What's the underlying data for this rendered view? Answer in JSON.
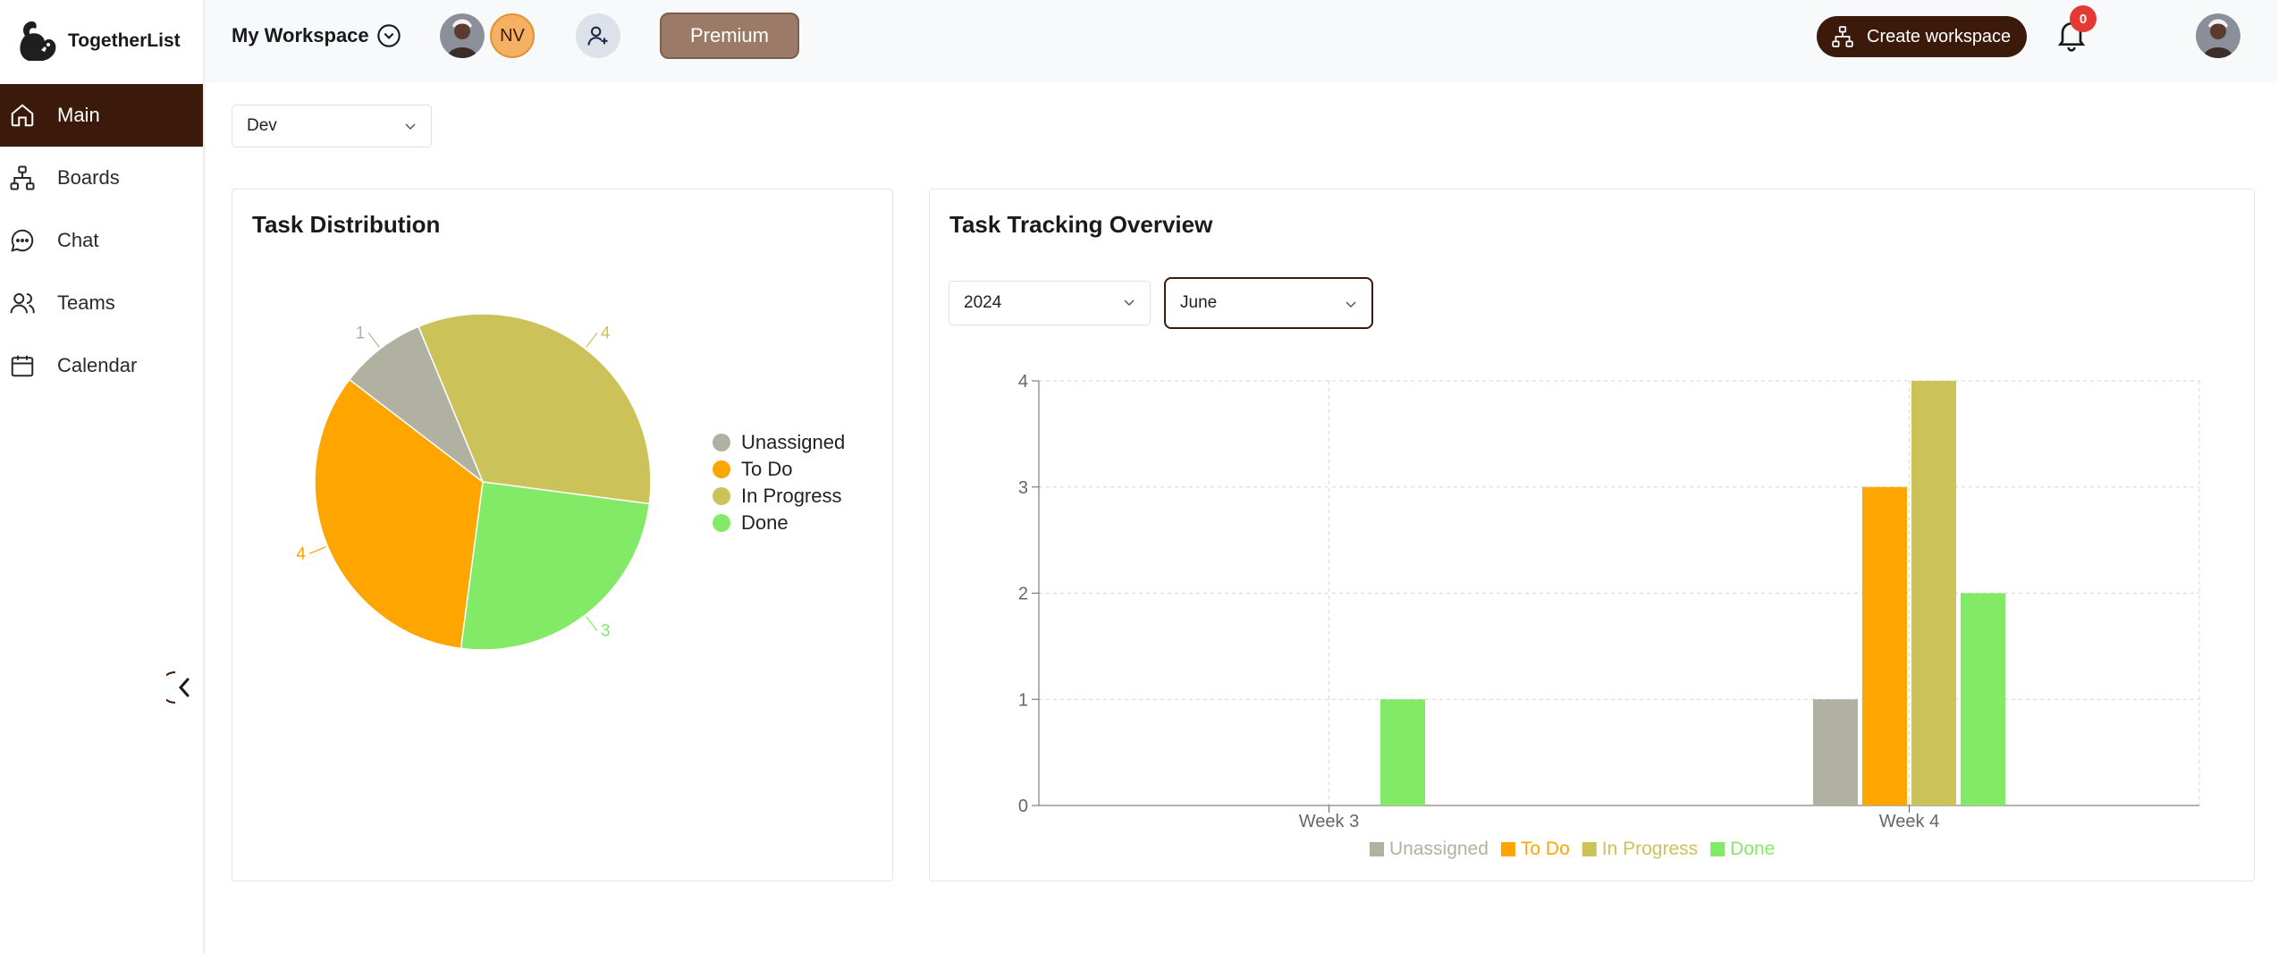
{
  "app": {
    "name": "TogetherList"
  },
  "sidebar": {
    "items": [
      {
        "label": "Main",
        "icon": "home-icon",
        "active": true
      },
      {
        "label": "Boards",
        "icon": "sitemap-icon",
        "active": false
      },
      {
        "label": "Chat",
        "icon": "chat-icon",
        "active": false
      },
      {
        "label": "Teams",
        "icon": "users-icon",
        "active": false
      },
      {
        "label": "Calendar",
        "icon": "calendar-icon",
        "active": false
      }
    ]
  },
  "topbar": {
    "workspace": "My Workspace",
    "member_initials": "NV",
    "premium_label": "Premium",
    "create_workspace_label": "Create workspace",
    "notification_count": "0"
  },
  "filters": {
    "board": "Dev",
    "year": "2024",
    "month": "June"
  },
  "colors": {
    "accent": "#3b1a0b",
    "unassigned": "#b1b1a2",
    "todo": "#ffa500",
    "in_progress": "#cbc25a",
    "done": "#82ea67"
  },
  "cards": {
    "distribution_title": "Task Distribution",
    "tracking_title": "Task Tracking Overview"
  },
  "chart_data": [
    {
      "type": "pie",
      "title": "Task Distribution",
      "categories": [
        "Unassigned",
        "To Do",
        "In Progress",
        "Done"
      ],
      "values": [
        1,
        4,
        4,
        3
      ],
      "legend": "right"
    },
    {
      "type": "bar",
      "title": "Task Tracking Overview",
      "categories": [
        "Week 3",
        "Week 4"
      ],
      "series": [
        {
          "name": "Unassigned",
          "values": [
            0,
            1
          ]
        },
        {
          "name": "To Do",
          "values": [
            0,
            3
          ]
        },
        {
          "name": "In Progress",
          "values": [
            0,
            4
          ]
        },
        {
          "name": "Done",
          "values": [
            1,
            2
          ]
        }
      ],
      "ylim": [
        0,
        4
      ],
      "yticks": [
        "0",
        "1",
        "2",
        "3",
        "4"
      ],
      "grid": true,
      "legend": "bottom"
    }
  ]
}
